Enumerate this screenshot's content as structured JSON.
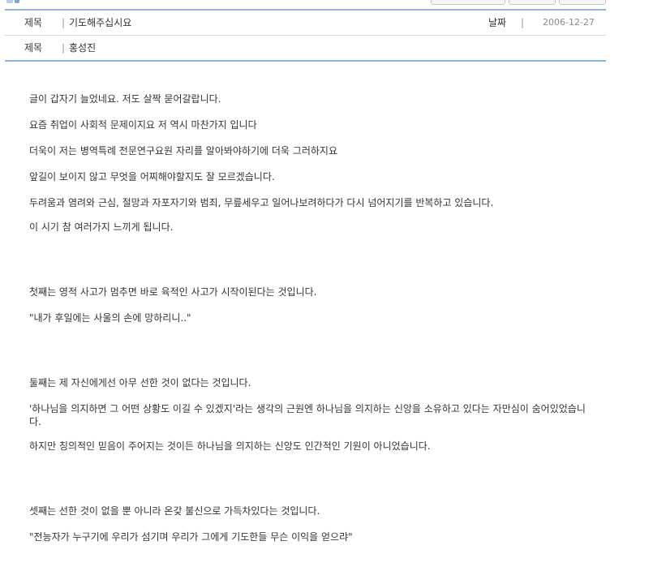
{
  "post": {
    "title_label": "제목",
    "title_value": "기도해주십시요",
    "date_label": "날짜",
    "date_value": "2006-12-27",
    "author_label": "제목",
    "author_value": "홍성진",
    "separator": "|"
  },
  "body": {
    "p1": "글이 갑자기 늘었네요. 저도 살짝 묻어갈랍니다.",
    "p2": "요즘 취업이 사회적 문제이지요 저 역시 마찬가지 입니다",
    "p3": "더욱이 저는 병역특례 전문연구요원 자리를 알아봐야하기에 더욱 그러하지요",
    "p4": "앞길이 보이지 않고 무엇을 어찌해야할지도 잘 모르겠습니다.",
    "p5": "두려움과 염려와 근심, 절망과 자포자기와 범죄, 무릎세우고 일어나보려하다가 다시 넘어지기를 반복하고 있습니다.",
    "p6": "이 시기 참 여러가지 느끼게 됩니다.",
    "p7": "첫째는 영적 사고가 멈추면 바로 육적인 사고가 시작이된다는 것입니다.",
    "p8": "\"내가 후일에는 사울의 손에 망하리니..\"",
    "p9": "둘째는 제 자신에게선 아무 선한 것이 없다는 것입니다.",
    "p10": "'하나님을 의지하면 그 어떤 상황도 이길 수 있겠지'라는 생각의 근원엔 하나님을 의지하는 신앙을 소유하고 있다는 자만심이 숨어있었습니다.",
    "p11": "하지만 칭의적인 믿음이 주어지는 것이든 하나님을 의지하는 신앙도 인간적인 기원이 아니었습니다.",
    "p12": "셋째는 선한 것이 없을 뿐 아니라 온갖 불신으로 가득차있다는 것입니다.",
    "p13": "\"전능자가 누구기에 우리가 섬기며 우리가 그에게 기도한들 무슨 이익을 얻으랴\""
  }
}
